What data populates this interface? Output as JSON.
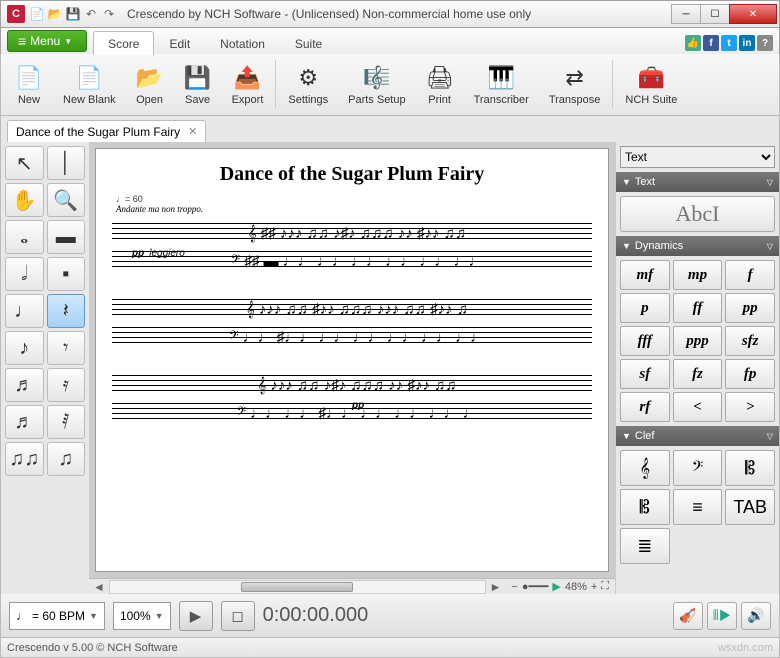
{
  "window": {
    "title": "Crescendo by NCH Software - (Unlicensed) Non-commercial home use only",
    "app_initial": "C"
  },
  "menu": {
    "button": "Menu",
    "tabs": [
      "Score",
      "Edit",
      "Notation",
      "Suite"
    ],
    "active": 0
  },
  "ribbon": [
    {
      "icon": "📄",
      "label": "New"
    },
    {
      "icon": "📄",
      "label": "New Blank"
    },
    {
      "icon": "📂",
      "label": "Open"
    },
    {
      "icon": "💾",
      "label": "Save"
    },
    {
      "icon": "📤",
      "label": "Export"
    },
    {
      "sep": true
    },
    {
      "icon": "⚙",
      "label": "Settings"
    },
    {
      "icon": "🎼",
      "label": "Parts Setup"
    },
    {
      "icon": "🖨",
      "label": "Print"
    },
    {
      "icon": "🎹",
      "label": "Transcriber"
    },
    {
      "icon": "⇄",
      "label": "Transpose"
    },
    {
      "sep": true
    },
    {
      "icon": "🧰",
      "label": "NCH Suite"
    }
  ],
  "doc": {
    "tab": "Dance of the Sugar Plum Fairy"
  },
  "score": {
    "title": "Dance of the Sugar Plum Fairy",
    "tempo_mark": "Andante ma non troppo.",
    "tempo_num": "♩= 60",
    "dynamic1": "pp",
    "expr1": "leggiero",
    "dynamic2": "pp"
  },
  "toolbox": {
    "items": [
      {
        "g": "↖",
        "name": "selection-tool"
      },
      {
        "g": "│",
        "name": "barline-tool"
      },
      {
        "g": "✋",
        "name": "hand-tool"
      },
      {
        "g": "🔍",
        "name": "zoom-tool"
      },
      {
        "g": "𝅝",
        "name": "whole-note"
      },
      {
        "g": "▬",
        "name": "whole-rest"
      },
      {
        "g": "𝅗𝅥",
        "name": "half-note"
      },
      {
        "g": "▪",
        "name": "half-rest"
      },
      {
        "g": "♩",
        "name": "quarter-note"
      },
      {
        "g": "𝄽",
        "name": "quarter-rest",
        "sel": true
      },
      {
        "g": "♪",
        "name": "eighth-note"
      },
      {
        "g": "𝄾",
        "name": "eighth-rest"
      },
      {
        "g": "♬",
        "name": "sixteenth-note"
      },
      {
        "g": "𝄿",
        "name": "sixteenth-rest"
      },
      {
        "g": "♬",
        "name": "thirtysecond-note"
      },
      {
        "g": "𝅀",
        "name": "thirtysecond-rest"
      },
      {
        "g": "♫♫",
        "name": "beam-tool"
      },
      {
        "g": "♫",
        "name": "tuplet-tool"
      }
    ]
  },
  "rpanel": {
    "selector": "Text",
    "text_section": "Text",
    "text_btn": "AbcI",
    "dyn_section": "Dynamics",
    "dynamics": [
      "mf",
      "mp",
      "f",
      "p",
      "ff",
      "pp",
      "fff",
      "ppp",
      "sfz",
      "sf",
      "fz",
      "fp",
      "rf",
      "<",
      ">"
    ],
    "clef_section": "Clef",
    "clefs": [
      "𝄞",
      "𝄢",
      "𝄡",
      "𝄡",
      "≡",
      "TAB",
      "≣"
    ]
  },
  "zoom": {
    "pct": "48%"
  },
  "transport": {
    "tempo": "= 60 BPM",
    "zoom": "100%",
    "time": "0:00:00.000"
  },
  "status": {
    "text": "Crescendo v 5.00 © NCH Software",
    "wm": "wsxdn.com"
  }
}
